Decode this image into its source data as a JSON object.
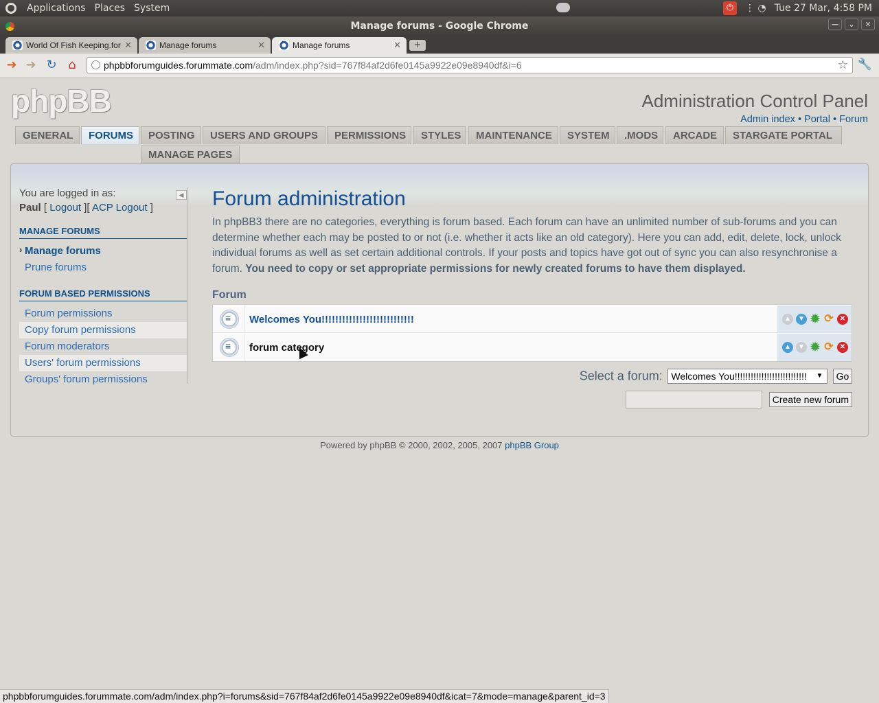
{
  "os_panel": {
    "menus": [
      "Applications",
      "Places",
      "System"
    ],
    "clock": "Tue 27 Mar,  4:58 PM"
  },
  "window": {
    "title": "Manage forums - Google Chrome"
  },
  "tabs": [
    {
      "label": "World Of Fish Keeping.for"
    },
    {
      "label": "Manage forums"
    },
    {
      "label": "Manage forums"
    }
  ],
  "address": {
    "host": "phpbbforumguides.forummate.com",
    "path": "/adm/index.php?sid=767f84af2d6fe0145a9922e09e8940df&i=6"
  },
  "header": {
    "logo": "phpBB",
    "title": "Administration Control Panel",
    "links": [
      "Admin index",
      "Portal",
      "Forum"
    ]
  },
  "menu_tabs": [
    "GENERAL",
    "FORUMS",
    "POSTING",
    "USERS AND GROUPS",
    "PERMISSIONS",
    "STYLES",
    "MAINTENANCE",
    "SYSTEM",
    ".MODS",
    "ARCADE",
    "STARGATE PORTAL",
    "MANAGE PAGES"
  ],
  "sidebar": {
    "logged_in_label": "You are logged in as:",
    "user": "Paul",
    "logout": "Logout",
    "acp_logout": "ACP Logout",
    "sections": [
      {
        "title": "MANAGE FORUMS",
        "items": [
          "Manage forums",
          "Prune forums"
        ]
      },
      {
        "title": "FORUM BASED PERMISSIONS",
        "items": [
          "Forum permissions",
          "Copy forum permissions",
          "Forum moderators",
          "Users' forum permissions",
          "Groups' forum permissions"
        ]
      }
    ]
  },
  "main": {
    "heading": "Forum administration",
    "intro": "In phpBB3 there are no categories, everything is forum based. Each forum can have an unlimited number of sub-forums and you can determine whether each may be posted to or not (i.e. whether it acts like an old category). Here you can add, edit, delete, lock, unlock individual forums as well as set certain additional controls. If your posts and topics have got out of sync you can also resynchronise a forum.",
    "intro_bold": "You need to copy or set appropriate permissions for newly created forums to have them displayed.",
    "section_label": "Forum",
    "forums": [
      {
        "name": "Welcomes You!!!!!!!!!!!!!!!!!!!!!!!!!!!"
      },
      {
        "name": "forum category"
      }
    ],
    "select_label": "Select a forum:",
    "select_value": "Welcomes You!!!!!!!!!!!!!!!!!!!!!!!!!!!",
    "go_label": "Go",
    "create_label": "Create new forum"
  },
  "footer": {
    "text": "Powered by phpBB © 2000, 2002, 2005, 2007",
    "link": "phpBB Group"
  },
  "status_url": "phpbbforumguides.forummate.com/adm/index.php?i=forums&sid=767f84af2d6fe0145a9922e09e8940df&icat=7&mode=manage&parent_id=3"
}
